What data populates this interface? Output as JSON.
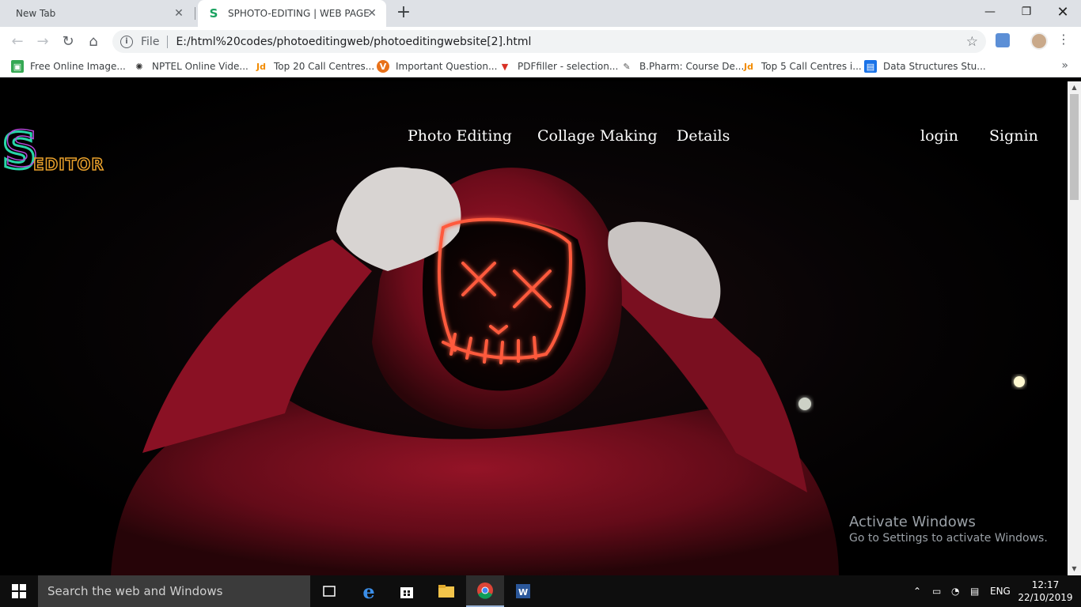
{
  "browser": {
    "tabs": [
      {
        "title": "New Tab"
      },
      {
        "title": "SPHOTO-EDITING | WEB PAGE",
        "favicon_letter": "S"
      }
    ],
    "new_tab_label": "+",
    "address": {
      "scheme_label": "File",
      "url": "E:/html%20codes/photoeditingweb/photoeditingwebsite[2].html"
    },
    "bookmarks": [
      {
        "label": "Free Online Image...",
        "icon": "image-icon",
        "color": "#34a853"
      },
      {
        "label": "NPTEL Online Vide...",
        "icon": "nptel-icon",
        "color": "#333333"
      },
      {
        "label": "Top 20 Call Centres...",
        "icon": "justdial-icon",
        "icon_text": "Jd",
        "color": "#f28b00"
      },
      {
        "label": "Important Question...",
        "icon": "v-icon",
        "icon_text": "V",
        "color": "#e8711a"
      },
      {
        "label": "PDFfiller - selection...",
        "icon": "pdffiller-icon",
        "color": "#d93025"
      },
      {
        "label": "B.Pharm: Course De...",
        "icon": "feather-icon",
        "color": "#555555"
      },
      {
        "label": "Top 5 Call Centres i...",
        "icon": "justdial-icon",
        "icon_text": "Jd",
        "color": "#f28b00"
      },
      {
        "label": "Data Structures Stu...",
        "icon": "doc-icon",
        "color": "#1a73e8"
      }
    ]
  },
  "site": {
    "logo": {
      "letter": "S",
      "word": "EDITOR"
    },
    "nav": [
      "Photo Editing",
      "Collage Making",
      "Details"
    ],
    "auth": [
      "login",
      "Signin"
    ]
  },
  "watermark": {
    "title": "Activate Windows",
    "subtitle": "Go to Settings to activate Windows."
  },
  "taskbar": {
    "search_placeholder": "Search the web and Windows",
    "language": "ENG",
    "time": "12:17",
    "date": "22/10/2019"
  }
}
